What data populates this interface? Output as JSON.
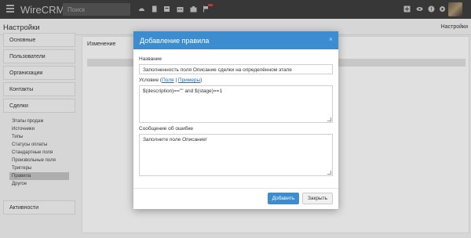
{
  "topbar": {
    "brand": "WireCRM",
    "search_placeholder": "Поиск",
    "icons": [
      "dashboard-icon",
      "document-icon",
      "contacts-icon",
      "building-icon",
      "briefcase-icon",
      "flag-icon",
      "plus-icon",
      "eye-icon",
      "help-icon",
      "gear-icon"
    ]
  },
  "page": {
    "title": "Настройки",
    "breadcrumb": "Настройки"
  },
  "sidebar": {
    "items": [
      {
        "label": "Основные"
      },
      {
        "label": "Пользователи"
      },
      {
        "label": "Организации"
      },
      {
        "label": "Контакты"
      },
      {
        "label": "Сделки"
      }
    ],
    "subitems": [
      "Этапы продаж",
      "Источники",
      "Типы",
      "Статусы оплаты",
      "Стандартные поля",
      "Произвольные поля",
      "Триггеры",
      "Правила",
      "Другое"
    ],
    "active_subitem": "Правила",
    "bottom_item": "Активности"
  },
  "content": {
    "column_header": "Изменение"
  },
  "dialog": {
    "title": "Добавление правила",
    "close_symbol": "×",
    "name_label": "Название",
    "name_value": "Заполненность поля Описание сделки на определённом этапе",
    "condition_label_prefix": "Условие (",
    "condition_link_fields": "Поля",
    "condition_separator": " | ",
    "condition_link_examples": "Примеры",
    "condition_label_suffix": ")",
    "condition_value": "$(description)==\"\" and $(stage)==1",
    "error_label": "Сообщение об ошибке",
    "error_value": "Заполните поле Описание!",
    "add_button": "Добавить",
    "close_button": "Закрыть"
  },
  "colors": {
    "topbar_bg": "#3f3f3f",
    "accent": "#3c8dcf"
  }
}
